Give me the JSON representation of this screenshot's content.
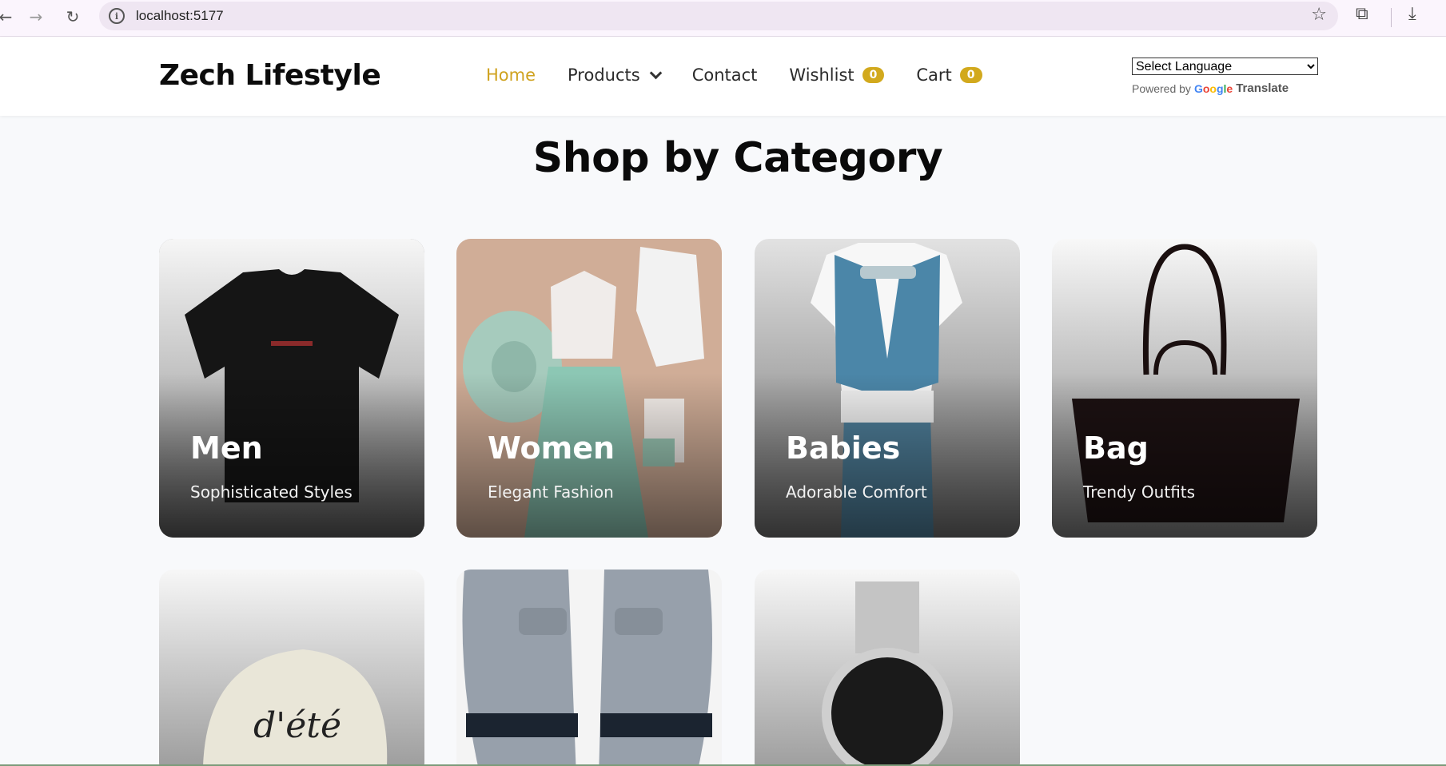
{
  "browser": {
    "url": "localhost:5177"
  },
  "header": {
    "logo": "Zech Lifestyle",
    "nav": {
      "home": "Home",
      "products": "Products",
      "contact": "Contact",
      "wishlist": "Wishlist",
      "wishlist_count": "0",
      "cart": "Cart",
      "cart_count": "0"
    },
    "language": {
      "select_label": "Select Language",
      "powered_by": "Powered by",
      "google": "Google",
      "translate": "Translate"
    }
  },
  "main": {
    "title": "Shop by Category",
    "categories": [
      {
        "title": "Men",
        "subtitle": "Sophisticated Styles",
        "image": "black-tshirt"
      },
      {
        "title": "Women",
        "subtitle": "Elegant Fashion",
        "image": "women-outfit-flatlay"
      },
      {
        "title": "Babies",
        "subtitle": "Adorable Comfort",
        "image": "baby-vest-suit"
      },
      {
        "title": "Bag",
        "subtitle": "Trendy Outfits",
        "image": "black-tote-bag"
      },
      {
        "title": "",
        "subtitle": "",
        "image": "cream-cap"
      },
      {
        "title": "",
        "subtitle": "",
        "image": "grey-slippers"
      },
      {
        "title": "",
        "subtitle": "",
        "image": "silver-watch"
      }
    ]
  },
  "colors": {
    "accent": "#cfa21f",
    "badge": "#d2a91d",
    "page_bg": "#f8f9fb"
  }
}
